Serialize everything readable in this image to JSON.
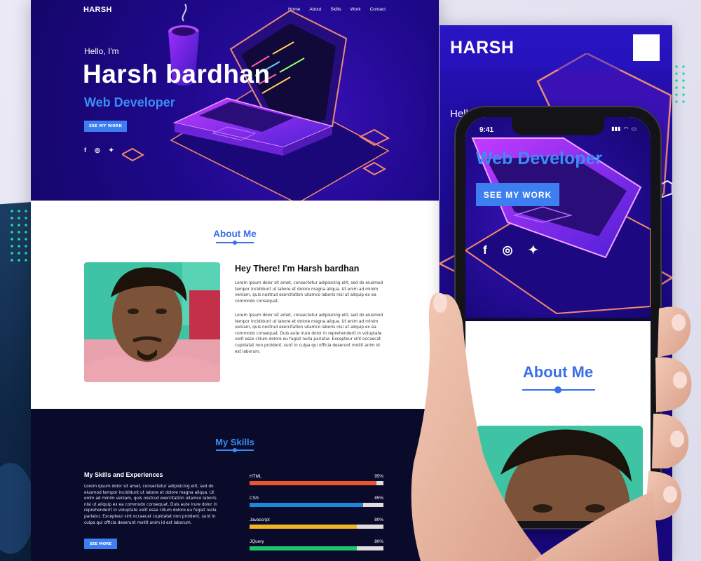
{
  "desktop": {
    "nav": {
      "logo": "HARSH",
      "links": [
        "Home",
        "About",
        "Skills",
        "Work",
        "Contact"
      ]
    },
    "hero": {
      "greeting": "Hello, I'm",
      "name": "Harsh bardhan",
      "role": "Web Developer",
      "button": "SEE MY WORK",
      "social_icons": [
        "facebook-icon",
        "instagram-icon",
        "twitter-icon"
      ]
    },
    "about": {
      "title": "About Me",
      "heading": "Hey There! I'm Harsh bardhan",
      "paragraph1": "Lorem ipsum dolor sit amet, consectetur adipisicing elit, sed do eiusmod tempor incididunt ut labore et dolore magna aliqua. Ut enim ad minim veniam, quis nostrud exercitation ullamco laboris nisi ut aliquip ex ea commodo consequat.",
      "paragraph2": "Lorem ipsum dolor sit amet, consectetur adipisicing elit, sed do eiusmod tempor incididunt ut labore et dolore magna aliqua. Ut enim ad minim veniam, quis nostrud exercitation ullamco laboris nisi ut aliquip ex ea commodo consequat. Duis aute irure dolor in reprehenderit in voluptate velit esse cillum dolore eu fugiat nulla pariatur. Excepteur sint occaecat cupidatat non proident, sunt in culpa qui officia deserunt mollit anim id est laborum."
    },
    "skills": {
      "title": "My Skills",
      "heading": "My Skills and Experiences",
      "paragraph": "Lorem ipsum dolor sit amet, consectetur adipisicing elit, sed do eiusmod tempor incididunt ut labore et dolore magna aliqua. Ut enim ad minim veniam, quis nostrud exercitation ullamco laboris nisi ut aliquip ex ea commodo consequat. Duis aute irure dolor in reprehenderit in voluptate velit esse cillum dolore eu fugiat nulla pariatur. Excepteur sint occaecat cupidatat non proident, sunt in culpa qui officia deserunt mollit anim id est laborum.",
      "button": "SEE MORE",
      "items": [
        {
          "name": "HTML",
          "percent": "95%",
          "level": 95,
          "color": "#e8552e"
        },
        {
          "name": "CSS",
          "percent": "85%",
          "level": 85,
          "color": "#1e88d8"
        },
        {
          "name": "Javascript",
          "percent": "80%",
          "level": 80,
          "color": "#f0b626"
        },
        {
          "name": "JQuery",
          "percent": "80%",
          "level": 80,
          "color": "#1ec66a"
        }
      ]
    }
  },
  "tablet": {
    "logo": "HARSH",
    "greeting": "Hello, I'm"
  },
  "phone": {
    "status_time": "9:41",
    "role": "Web Developer",
    "button": "SEE MY WORK",
    "social_icons": [
      "facebook-icon",
      "instagram-icon",
      "twitter-icon"
    ],
    "about_title": "About Me"
  },
  "colors": {
    "accent": "#3d7ef0",
    "hero_bg": "#20098f",
    "skills_bg": "#0a0a2a"
  }
}
